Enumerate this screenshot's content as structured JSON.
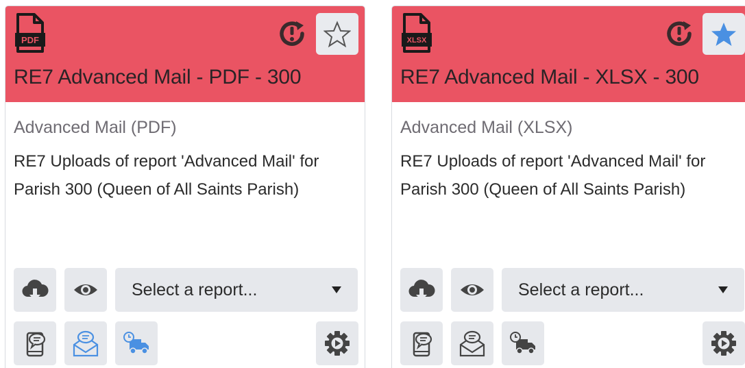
{
  "colors": {
    "header": "#ea5463",
    "button_bg": "#e6e8ec",
    "active_blue": "#4a90e2",
    "icon_dark": "#444444"
  },
  "cards": [
    {
      "file_badge": "PDF",
      "file_icon": "pdf-file-icon",
      "favorite": false,
      "title": "RE7 Advanced Mail - PDF - 300",
      "subtitle": "Advanced Mail (PDF)",
      "description": "RE7 Uploads of report 'Advanced Mail' for Parish 300 (Queen of All Saints Parish)",
      "select_placeholder": "Select a report...",
      "email_active": true,
      "delivery_active": true
    },
    {
      "file_badge": "XLSX",
      "file_icon": "xlsx-file-icon",
      "favorite": true,
      "title": "RE7 Advanced Mail - XLSX - 300",
      "subtitle": "Advanced Mail (XLSX)",
      "description": "RE7 Uploads of report 'Advanced Mail' for Parish 300 (Queen of All Saints Parish)",
      "select_placeholder": "Select a report...",
      "email_active": false,
      "delivery_active": false
    }
  ]
}
